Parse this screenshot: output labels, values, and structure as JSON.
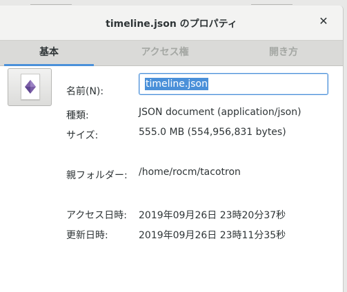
{
  "window": {
    "title": "timeline.json のプロパティ",
    "close_glyph": "✕"
  },
  "tabs": [
    {
      "label": "基本",
      "active": true
    },
    {
      "label": "アクセス権",
      "active": false
    },
    {
      "label": "開き方",
      "active": false
    }
  ],
  "file": {
    "icon": "json-file-icon",
    "name_label": "名前(N):",
    "name_value": "timeline.json",
    "type_label": "種類:",
    "type_value": "JSON document (application/json)",
    "size_label": "サイズ:",
    "size_value": "555.0 MB (554,956,831 bytes)",
    "parent_label": "親フォルダー:",
    "parent_value": "/home/rocm/tacotron",
    "accessed_label": "アクセス日時:",
    "accessed_value": "2019年09月26日 23時20分37秒",
    "modified_label": "更新日時:",
    "modified_value": "2019年09月26日 23時11分35秒"
  },
  "colors": {
    "accent": "#4a90d9",
    "icon_purple": "#7b5ea7"
  }
}
